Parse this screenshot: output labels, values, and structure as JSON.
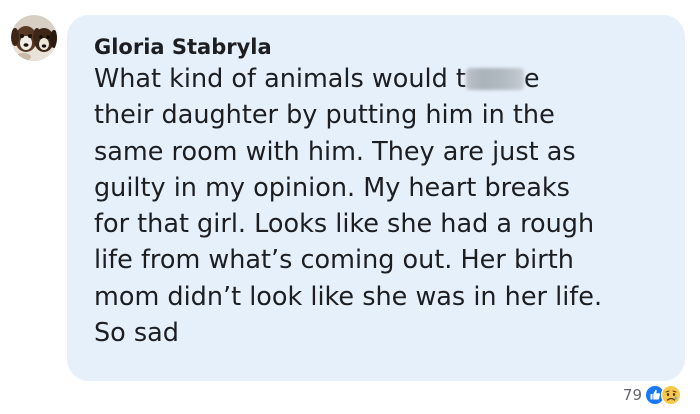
{
  "comment": {
    "author": "Gloria Stabryla",
    "text_lines": [
      [
        "What kind of animals would t",
        "e"
      ],
      "their daughter by putting him in the",
      "same room with him. They are just as",
      "guilty in my opinion. My heart breaks",
      "for that girl. Looks like she had a rough",
      "life from what’s coming out. Her birth",
      "mom didn’t look like she was in her life.",
      "So sad"
    ]
  },
  "reactions": {
    "count": "79",
    "icons": [
      "like-icon",
      "sad-icon"
    ]
  },
  "colors": {
    "bubble": "#e6f0fb",
    "text": "#1c1e21",
    "muted": "#65676b",
    "like_blue": "#1877f2",
    "sad_yellow": "#f7c94b"
  }
}
